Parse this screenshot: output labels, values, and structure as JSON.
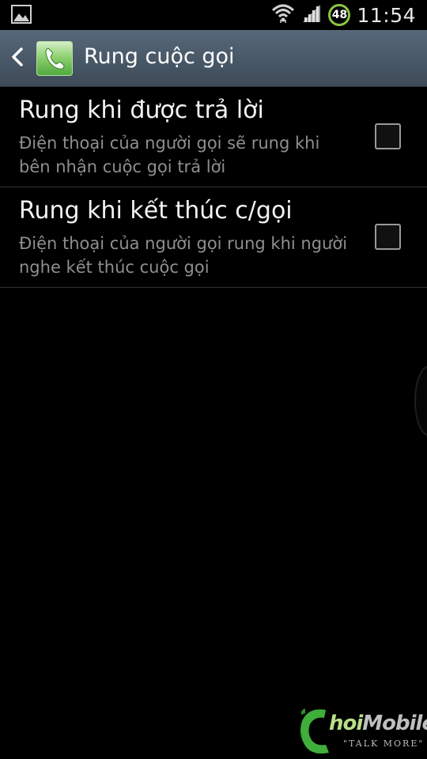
{
  "status_bar": {
    "left_icon": "gallery-image-icon",
    "wifi_icon": "wifi-icon",
    "signal_icon": "signal-icon",
    "battery_level": "48",
    "time": "11:54"
  },
  "action_bar": {
    "back_icon": "chevron-left-icon",
    "app_icon": "phone-app-icon",
    "title": "Rung cuộc gọi"
  },
  "settings": {
    "items": [
      {
        "title": "Rung khi được trả lời",
        "description": "Điện thoại của người gọi sẽ rung khi bên nhận cuộc gọi trả lời",
        "checked": false
      },
      {
        "title": "Rung khi kết thúc c/gọi",
        "description": "Điện thoại của người gọi rung khi người nghe kết thúc cuộc gọi",
        "checked": false
      }
    ]
  },
  "watermark": {
    "brand_prefix": "hoi",
    "brand_rest": "Mobile",
    "tagline": "\"TALK MORE\""
  },
  "colors": {
    "action_bar": "#4a5a6a",
    "battery_ring": "#8cc63f",
    "title_text": "#f2f2f2",
    "desc_text": "#8f8f8f"
  }
}
